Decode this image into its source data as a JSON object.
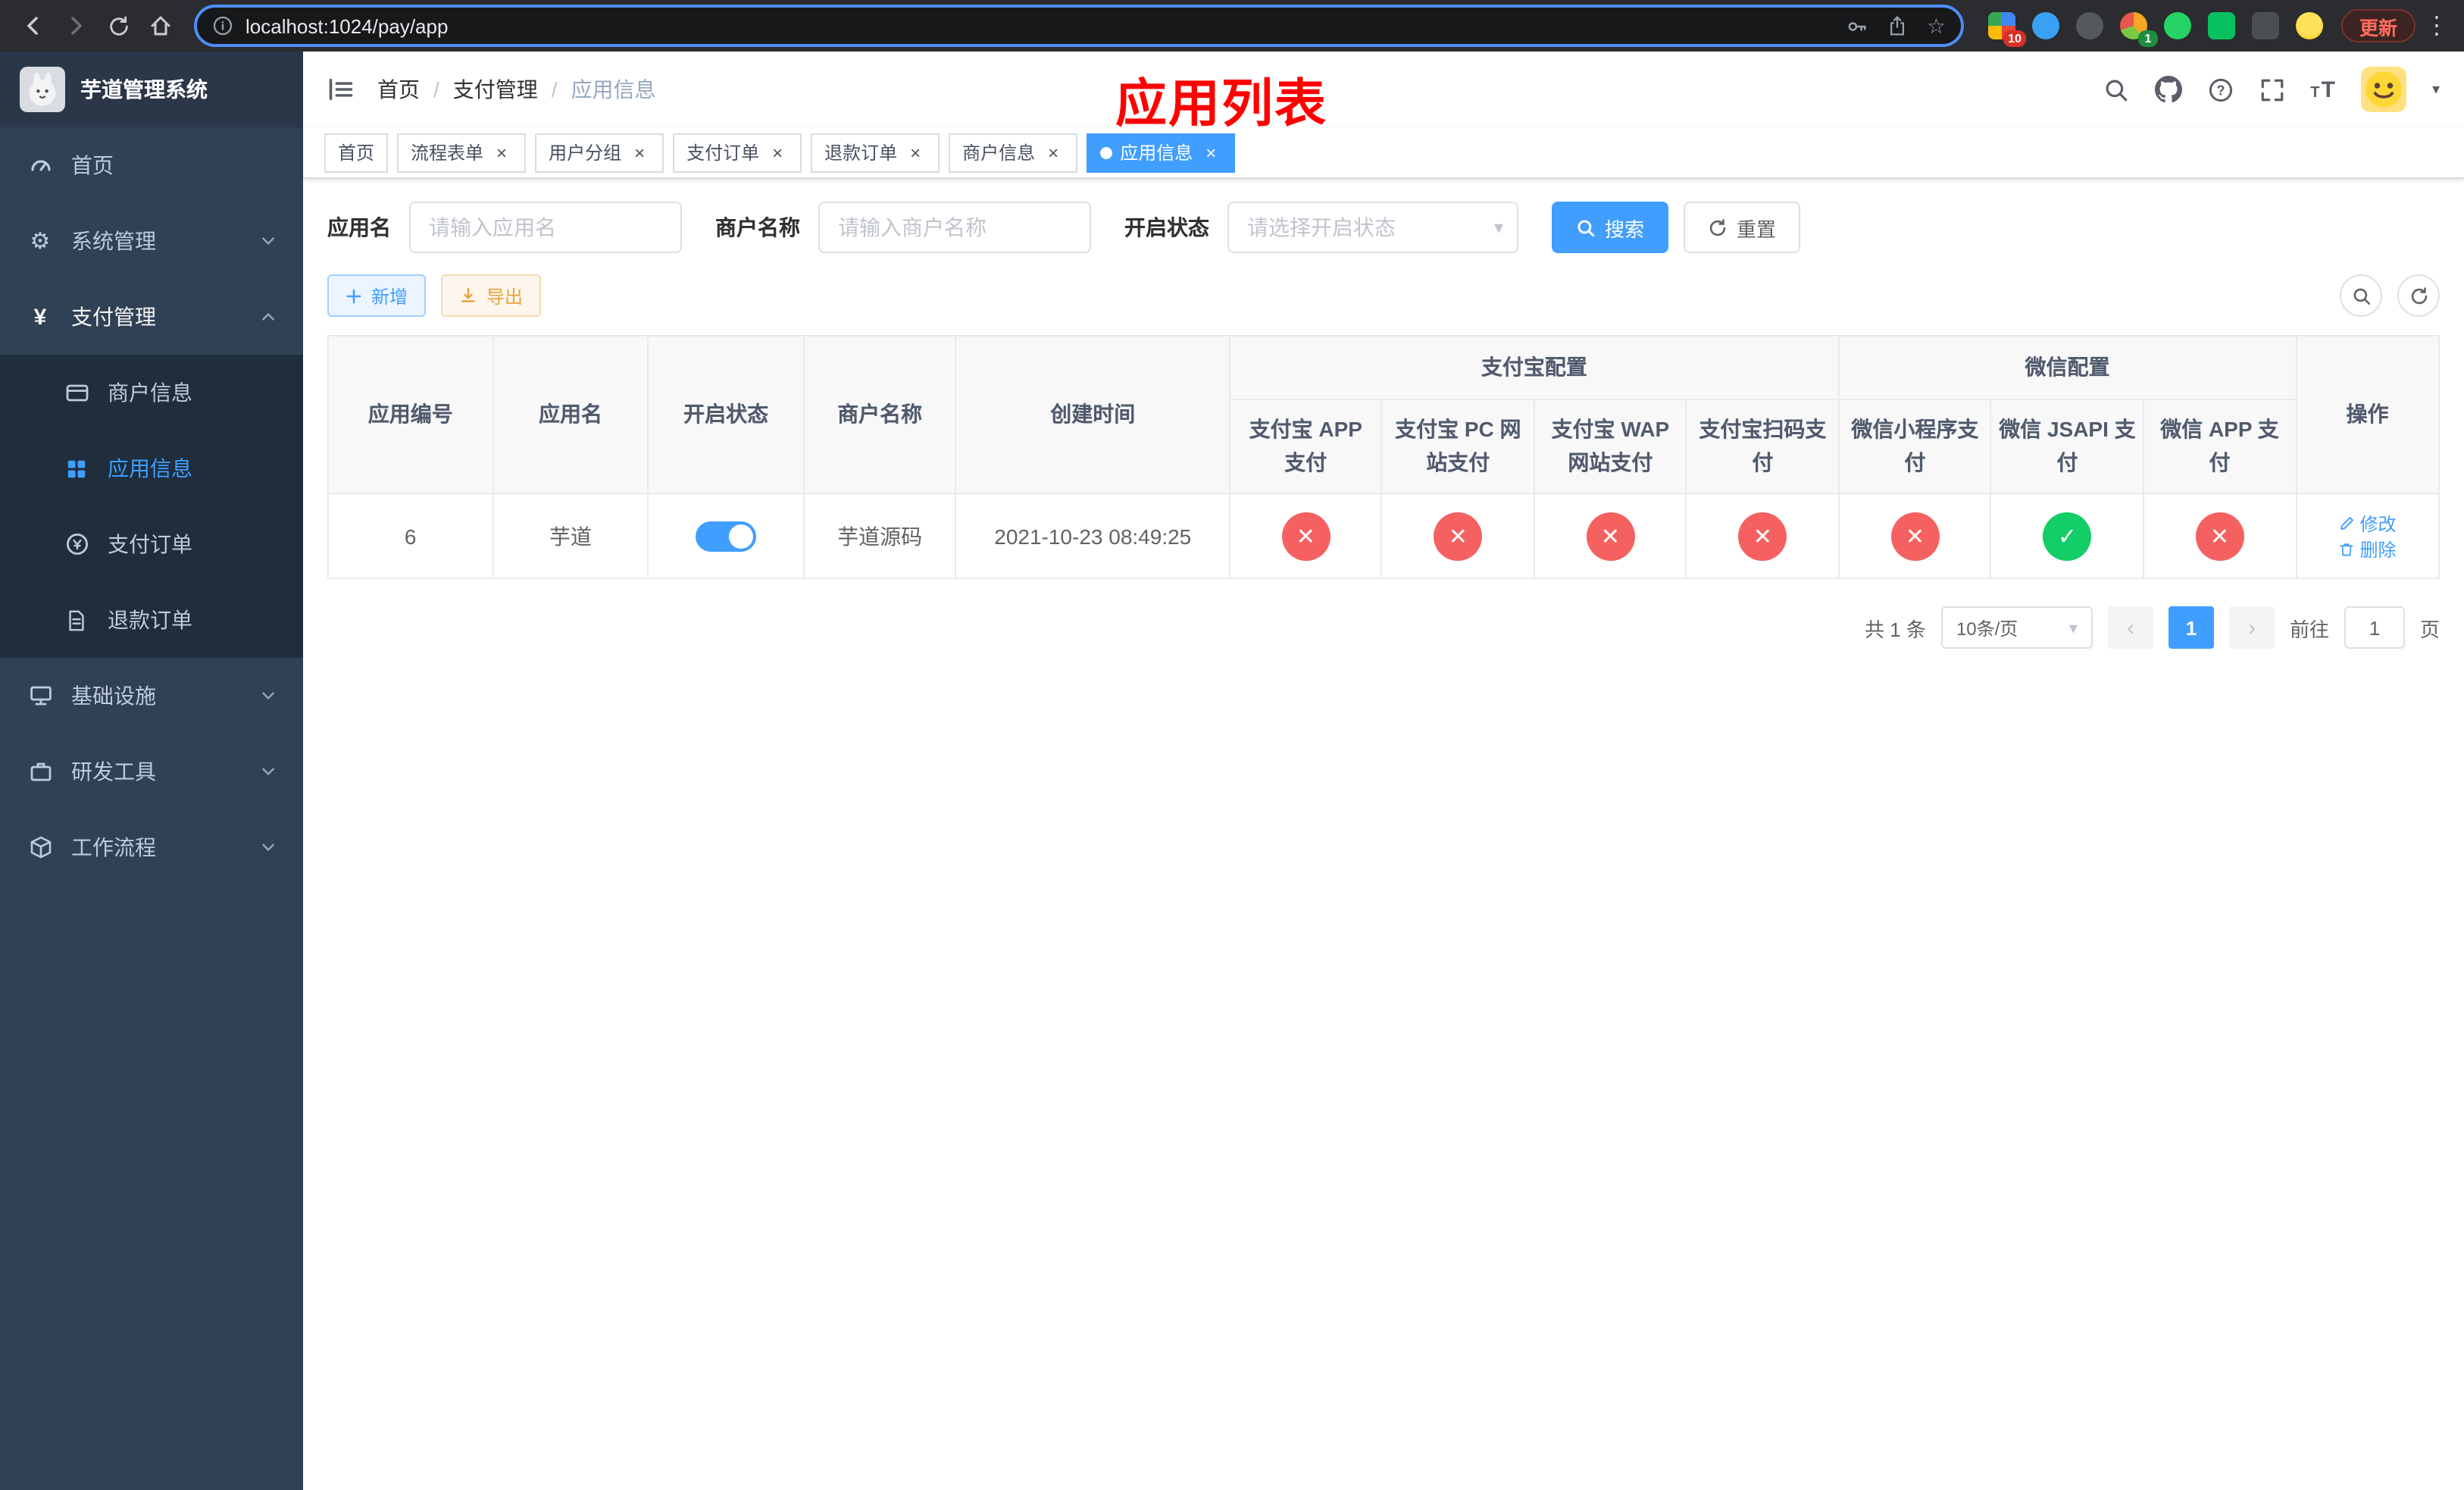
{
  "colors": {
    "accent": "#409eff",
    "danger": "#f56161",
    "success": "#13ce66",
    "title_red": "#ff0000",
    "sidebar_bg": "#304156",
    "submenu_bg": "#1f2d3d"
  },
  "icons": {
    "cross": "✕",
    "check": "✓",
    "close": "×",
    "slash": "/",
    "caret_down": "▾",
    "dots": "⋮",
    "prev": "‹",
    "next": "›",
    "star": "☆",
    "gear": "⚙",
    "yen": "¥",
    "font_size_small": "T",
    "font_size_big": "T"
  },
  "browser": {
    "url": "localhost:1024/pay/app",
    "update_label": "更新",
    "ext_badges": {
      "palette": "10",
      "proxy": "1"
    }
  },
  "sidebar": {
    "app_title": "芋道管理系统",
    "home": "首页",
    "system": "系统管理",
    "payment": "支付管理",
    "merchant": "商户信息",
    "app_info": "应用信息",
    "pay_order": "支付订单",
    "refund_order": "退款订单",
    "infra": "基础设施",
    "dev_tools": "研发工具",
    "workflow": "工作流程"
  },
  "navbar": {
    "breadcrumb": [
      "首页",
      "支付管理",
      "应用信息"
    ],
    "page_title": "应用列表"
  },
  "tabs": {
    "home": "首页",
    "t1": "流程表单",
    "t2": "用户分组",
    "t3": "支付订单",
    "t4": "退款订单",
    "t5": "商户信息",
    "t6": "应用信息"
  },
  "search": {
    "app_name_label": "应用名",
    "app_name_placeholder": "请输入应用名",
    "merchant_label": "商户名称",
    "merchant_placeholder": "请输入商户名称",
    "status_label": "开启状态",
    "status_placeholder": "请选择开启状态",
    "search_button": "搜索",
    "reset_button": "重置"
  },
  "toolbar": {
    "add_button": "新增",
    "export_button": "导出"
  },
  "table": {
    "group_alipay": "支付宝配置",
    "group_wechat": "微信配置",
    "col_id": "应用编号",
    "col_name": "应用名",
    "col_status": "开启状态",
    "col_merchant": "商户名称",
    "col_created": "创建时间",
    "col_alipay_app": "支付宝 APP 支付",
    "col_alipay_pc": "支付宝 PC 网站支付",
    "col_alipay_wap": "支付宝 WAP 网站支付",
    "col_alipay_qr": "支付宝扫码支付",
    "col_wx_lite": "微信小程序支付",
    "col_wx_jsapi": "微信 JSAPI 支付",
    "col_wx_app": "微信 APP 支付",
    "col_actions": "操作",
    "rows": [
      {
        "id": "6",
        "name": "芋道",
        "status_on": true,
        "merchant": "芋道源码",
        "created": "2021-10-23 08:49:25",
        "configs": {
          "alipay_app": false,
          "alipay_pc": false,
          "alipay_wap": false,
          "alipay_qr": false,
          "wx_lite": false,
          "wx_jsapi": true,
          "wx_app": false
        },
        "edit_label": "修改",
        "delete_label": "删除"
      }
    ]
  },
  "pagination": {
    "total_text": "共 1 条",
    "page_size_text": "10条/页",
    "current_page": "1",
    "goto_prefix": "前往",
    "goto_value": "1",
    "goto_suffix": "页"
  }
}
